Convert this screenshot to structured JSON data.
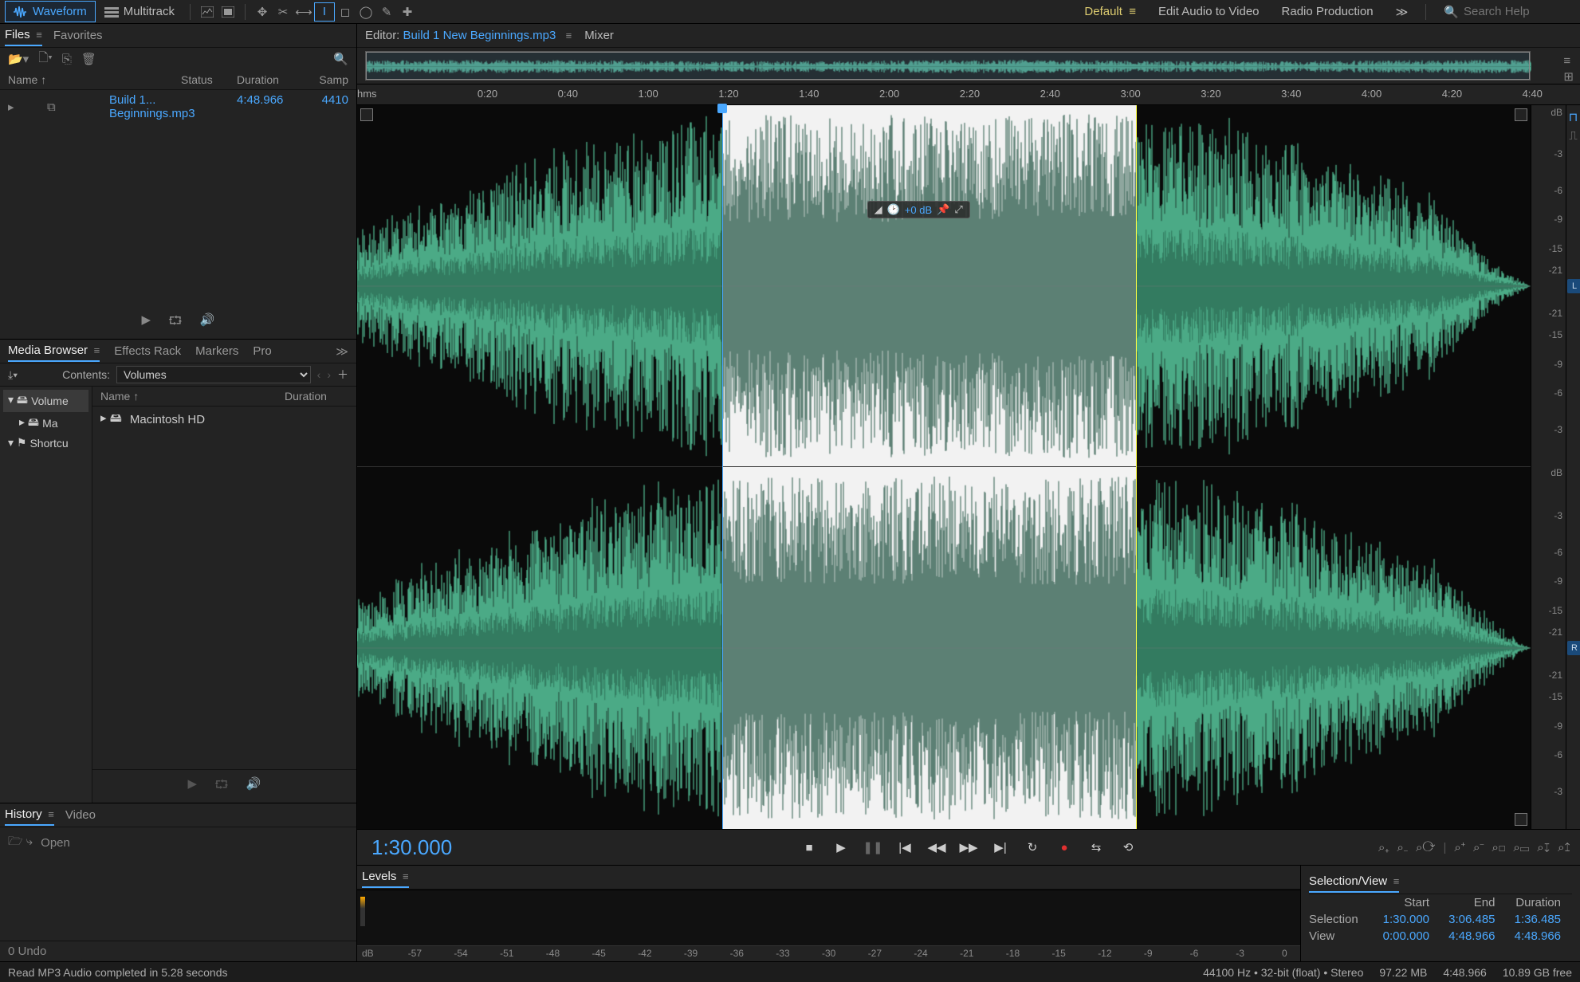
{
  "top": {
    "mode_waveform": "Waveform",
    "mode_multitrack": "Multitrack",
    "workspaces": {
      "default": "Default",
      "eav": "Edit Audio to Video",
      "rp": "Radio Production"
    },
    "search_placeholder": "Search Help"
  },
  "files": {
    "tab_files": "Files",
    "tab_favorites": "Favorites",
    "cols": {
      "name": "Name ↑",
      "status": "Status",
      "duration": "Duration",
      "sample": "Samp"
    },
    "rows": [
      {
        "name": "Build 1... Beginnings.mp3",
        "status": "",
        "duration": "4:48.966",
        "sample": "4410"
      }
    ],
    "footer_play": "▶",
    "footer_loop": "↻",
    "footer_auto": "🔊"
  },
  "mb": {
    "tabs": {
      "mb": "Media Browser",
      "fx": "Effects Rack",
      "markers": "Markers",
      "props": "Pro"
    },
    "contents_label": "Contents:",
    "contents_value": "Volumes",
    "tree": [
      {
        "label": "Volume",
        "sel": true,
        "icon": "drive"
      },
      {
        "label": "Ma",
        "indent": 1,
        "icon": "drive"
      },
      {
        "label": "Shortcu",
        "icon": "star"
      }
    ],
    "cols": {
      "name": "Name ↑",
      "duration": "Duration"
    },
    "rows": [
      {
        "name": "Macintosh HD",
        "icon": "drive"
      }
    ]
  },
  "hist": {
    "tab_history": "History",
    "tab_video": "Video",
    "items": [
      {
        "label": "Open",
        "icon": "open"
      }
    ],
    "footer": "0 Undo"
  },
  "editor": {
    "tab_editor_prefix": "Editor:",
    "filename": "Build 1 New Beginnings.mp3",
    "tab_mixer": "Mixer"
  },
  "ruler": {
    "unit": "hms",
    "ticks": [
      "0:20",
      "0:40",
      "1:00",
      "1:20",
      "1:40",
      "2:00",
      "2:20",
      "2:40",
      "3:00",
      "3:20",
      "3:40",
      "4:00",
      "4:20",
      "4:40"
    ]
  },
  "selection": {
    "playhead_pct": 31.1,
    "sel_end_pct": 66.4
  },
  "amp": {
    "unit": "dB",
    "marks": [
      "-3",
      "-6",
      "-9",
      "-15",
      "-21",
      "-21",
      "-15",
      "-9",
      "-6",
      "-3"
    ],
    "L": "L",
    "R": "R"
  },
  "hud": {
    "value": "+0 dB"
  },
  "transport": {
    "timecode": "1:30.000",
    "buttons": [
      "stop",
      "play",
      "pause",
      "prev",
      "rewind",
      "ffwd",
      "next",
      "loop",
      "record",
      "skip",
      "punch"
    ]
  },
  "levels": {
    "title": "Levels",
    "marks": [
      "dB",
      "-57",
      "-54",
      "-51",
      "-48",
      "-45",
      "-42",
      "-39",
      "-36",
      "-33",
      "-30",
      "-27",
      "-24",
      "-21",
      "-18",
      "-15",
      "-12",
      "-9",
      "-6",
      "-3",
      "0"
    ]
  },
  "selview": {
    "title": "Selection/View",
    "hdr": {
      "start": "Start",
      "end": "End",
      "duration": "Duration"
    },
    "rows": [
      {
        "label": "Selection",
        "start": "1:30.000",
        "end": "3:06.485",
        "dur": "1:36.485"
      },
      {
        "label": "View",
        "start": "0:00.000",
        "end": "4:48.966",
        "dur": "4:48.966"
      }
    ]
  },
  "status": {
    "left": "Read MP3 Audio completed in 5.28 seconds",
    "right": [
      "44100 Hz • 32-bit (float) • Stereo",
      "97.22 MB",
      "4:48.966",
      "10.89 GB free"
    ]
  }
}
